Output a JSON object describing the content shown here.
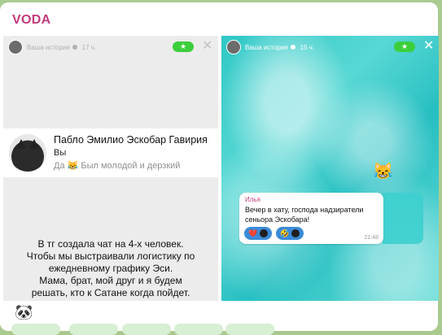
{
  "message": {
    "sender": "VODA"
  },
  "story_left": {
    "title": "Ваша история",
    "time": "17 ч.",
    "star_label": "★",
    "close_label": "✕",
    "profile": {
      "name": "Пабло Эмилио Эскобар Гавирия",
      "you_label": "Вы",
      "status": "Да 😹 Был молодой и дерзкий"
    },
    "caption": [
      "В тг создала чат на 4-х человек.",
      "Чтобы мы выстраивали логистику по",
      "ежедневному графику Эси.",
      "Мама, брат, мой друг и я будем",
      "решать, кто к Сатане когда пойдет."
    ]
  },
  "story_right": {
    "title": "Ваша история",
    "time": "15 ч.",
    "star_label": "★",
    "close_label": "✕",
    "emoji": "😹",
    "quote": {
      "author": "Илья",
      "text": "Вечер в хату, господа надзиратели сеньора Эскобара!",
      "reaction_1_emoji": "❤️",
      "reaction_2_emoji": "🤣",
      "time": "21:48"
    }
  },
  "bottom": {
    "emoji": "🐼"
  }
}
